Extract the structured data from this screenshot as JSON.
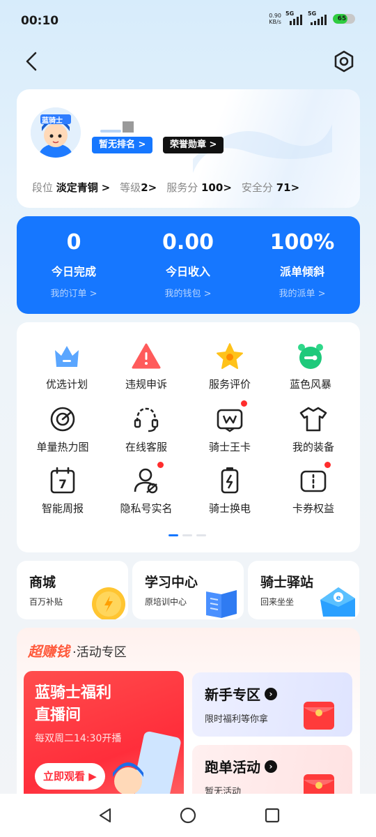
{
  "status_bar": {
    "time": "00:10",
    "net_speed_value": "0.90",
    "net_speed_unit": "KB/s",
    "signal1": "5G",
    "signal2": "5G",
    "battery": "65"
  },
  "profile": {
    "avatar_badge": "蓝骑士",
    "rank_label": "暂无排名 >",
    "medal_label": "荣誉勋章 >",
    "stats": [
      {
        "label": "段位",
        "value": "淡定青铜",
        "arrow": ">"
      },
      {
        "label": "等级",
        "value": "2",
        "arrow": ">"
      },
      {
        "label": "服务分",
        "value": "100",
        "arrow": ">"
      },
      {
        "label": "安全分",
        "value": "71",
        "arrow": ">"
      }
    ]
  },
  "summary": [
    {
      "value": "0",
      "label": "今日完成",
      "link": "我的订单 >"
    },
    {
      "value": "0.00",
      "label": "今日收入",
      "link": "我的钱包 >"
    },
    {
      "value": "100%",
      "label": "派单倾斜",
      "link": "我的派单 >"
    }
  ],
  "grid": [
    {
      "label": "优选计划",
      "icon": "crown-icon",
      "dot": false
    },
    {
      "label": "违规申诉",
      "icon": "warning-icon",
      "dot": false
    },
    {
      "label": "服务评价",
      "icon": "star-icon",
      "dot": false
    },
    {
      "label": "蓝色风暴",
      "icon": "alarm-clock-icon",
      "dot": false
    },
    {
      "label": "单量热力图",
      "icon": "heatmap-icon",
      "dot": false
    },
    {
      "label": "在线客服",
      "icon": "headset-icon",
      "dot": false
    },
    {
      "label": "骑士王卡",
      "icon": "card-icon",
      "dot": true
    },
    {
      "label": "我的装备",
      "icon": "tshirt-icon",
      "dot": false
    },
    {
      "label": "智能周报",
      "icon": "calendar-icon",
      "dot": false
    },
    {
      "label": "隐私号实名",
      "icon": "privacy-user-icon",
      "dot": true
    },
    {
      "label": "骑士换电",
      "icon": "battery-swap-icon",
      "dot": false
    },
    {
      "label": "卡券权益",
      "icon": "coupon-icon",
      "dot": true
    }
  ],
  "entries": [
    {
      "title": "商城",
      "sub": "百万补贴"
    },
    {
      "title": "学习中心",
      "sub": "原培训中心"
    },
    {
      "title": "骑士驿站",
      "sub": "回来坐坐"
    }
  ],
  "promo": {
    "brand": "超赚钱",
    "dot": "·",
    "zone": "活动专区",
    "live_title_1": "蓝骑士福利",
    "live_title_2": "直播间",
    "live_time": "每双周二14:30开播",
    "watch_label": "立即观看",
    "newbie_title": "新手专区",
    "newbie_sub": "限时福利等你拿",
    "run_title": "跑单活动",
    "run_sub": "暂无活动"
  },
  "colors": {
    "primary": "#1677ff",
    "accent_red": "#ff2e3b",
    "promo_orange": "#ff5a3c"
  }
}
